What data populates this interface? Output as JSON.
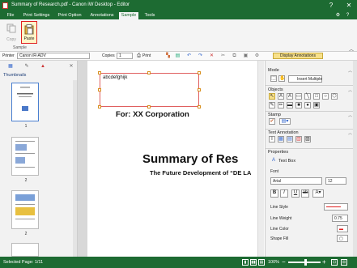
{
  "window": {
    "title": "Summary of Research.pdf - Canon iW Desktop - Editor",
    "help_label": "?",
    "close_label": "✕"
  },
  "ribbon_tabs": [
    "File",
    "Print Settings",
    "Print Option",
    "Annotations",
    "Sample",
    "Tools"
  ],
  "ribbon": {
    "copy_label": "Copy",
    "paste_label": "Paste",
    "group_label": "Sample"
  },
  "toolbar": {
    "printer_label": "Printer",
    "printer_value": "Canon iR-ADV",
    "copies_label": "Copies",
    "copies_value": "1",
    "print_label": "Print",
    "display_annotations": "Display Annotations"
  },
  "left_panel": {
    "header": "Thumbnails",
    "pages": [
      "1",
      "2",
      "2"
    ]
  },
  "document": {
    "textbox_text": "abcdefghijk",
    "line1": "For: XX Corporation",
    "line2": "Summary of Res",
    "line3": "The Future Development of “DE LA"
  },
  "right_panel": {
    "mode_label": "Mode",
    "insert_multiple": "Insert Multiple",
    "objects_label": "Objects",
    "stamp_label": "Stamp",
    "text_annotation_label": "Text Annotation",
    "properties_label": "Properties",
    "text_box_label": "Text Box",
    "font_label": "Font",
    "font_value": "Arial",
    "font_size": "12",
    "line_style_label": "Line Style",
    "line_weight_label": "Line Weight",
    "line_weight_value": "0.75",
    "line_color_label": "Line Color",
    "shape_fill_label": "Shape Fill"
  },
  "status": {
    "selected_page": "Selected Page: 1/11",
    "zoom": "100%"
  },
  "colors": {
    "brand_green": "#1d6b32",
    "highlight_red": "#e02020"
  }
}
